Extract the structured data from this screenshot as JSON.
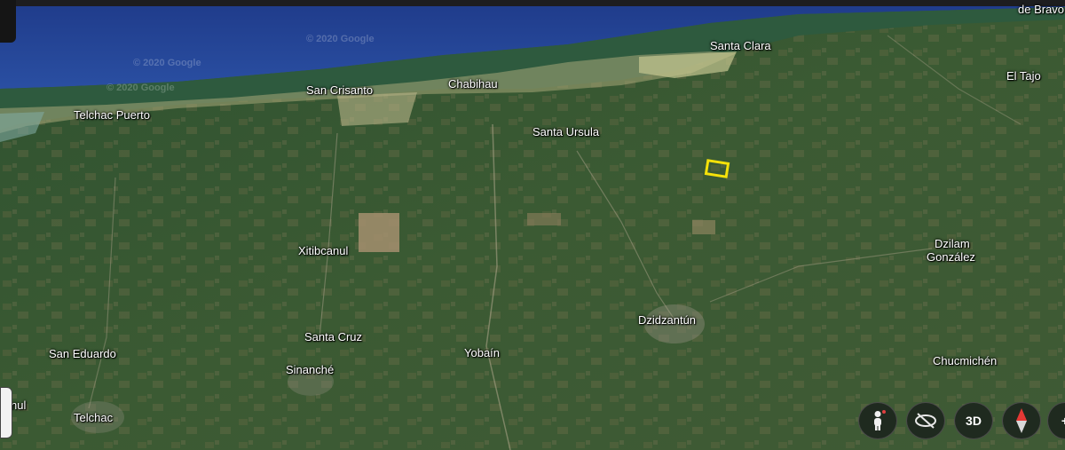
{
  "map": {
    "copyright": [
      "© 2020 Google",
      "© 2020 Google",
      "© 2020 Google"
    ],
    "places": [
      {
        "id": "de-bravo",
        "label": "de Bravo"
      },
      {
        "id": "santa-clara",
        "label": "Santa Clara"
      },
      {
        "id": "el-tajo",
        "label": "El Tajo"
      },
      {
        "id": "san-crisanto",
        "label": "San Crisanto"
      },
      {
        "id": "chabihau",
        "label": "Chabihau"
      },
      {
        "id": "telchac-puerto",
        "label": "Telchac Puerto"
      },
      {
        "id": "santa-ursula",
        "label": "Santa Ursula"
      },
      {
        "id": "xitibcanul",
        "label": "Xitibcanul"
      },
      {
        "id": "dzilam-gonzalez-1",
        "label": "Dzilam"
      },
      {
        "id": "dzilam-gonzalez-2",
        "label": "González"
      },
      {
        "id": "dzidzantun",
        "label": "Dzidzantún"
      },
      {
        "id": "santa-cruz",
        "label": "Santa Cruz"
      },
      {
        "id": "san-eduardo",
        "label": "San Eduardo"
      },
      {
        "id": "yobain",
        "label": "Yobaín"
      },
      {
        "id": "sinanche",
        "label": "Sinanché"
      },
      {
        "id": "chucmichen",
        "label": "Chucmichén"
      },
      {
        "id": "nul",
        "label": "nul"
      },
      {
        "id": "telchac",
        "label": "Telchac"
      }
    ],
    "highlight_color": "#f5e10a"
  },
  "controls": {
    "pegman": {
      "icon": "pegman-icon"
    },
    "tilt": {
      "icon": "tilt-icon"
    },
    "three_d_label": "3D",
    "compass": {
      "icon": "compass-icon"
    },
    "zoom": {
      "label": "+"
    }
  }
}
